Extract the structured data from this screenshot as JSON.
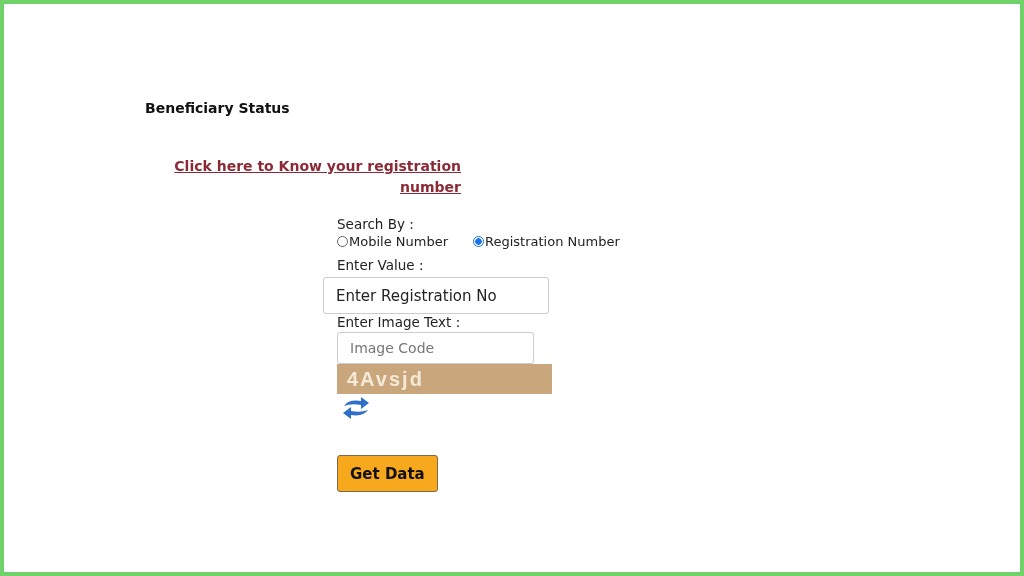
{
  "title": "Beneficiary Status",
  "registration_link": "Click here to Know your registration number",
  "search_by": {
    "label": "Search By :",
    "options": [
      {
        "label": "Mobile Number",
        "selected": false
      },
      {
        "label": "Registration Number",
        "selected": true
      }
    ]
  },
  "value_field": {
    "label": "Enter Value :",
    "placeholder": "Enter Registration No"
  },
  "image_field": {
    "label": "Enter Image Text :",
    "placeholder": "Image Code"
  },
  "captcha_text": "4Avsjd",
  "submit_button": "Get Data"
}
